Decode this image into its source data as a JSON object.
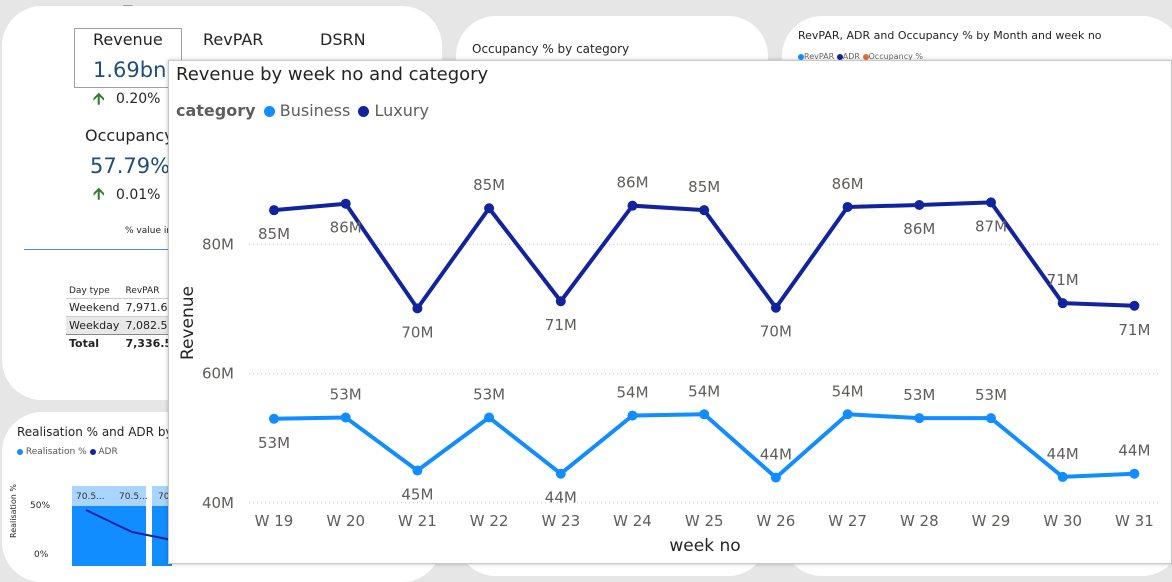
{
  "toolbar": {
    "filter_icon": "filter-icon",
    "more_icon": "more-options-icon"
  },
  "kpi_card": {
    "tabs": [
      "Revenue",
      "RevPAR",
      "DSRN"
    ],
    "revenue_value": "1.69bn",
    "revenue_change": "0.20%",
    "occupancy_label": "Occupancy",
    "occupancy_value": "57.79%",
    "occupancy_change": "0.01%",
    "note": "% value in"
  },
  "day_table": {
    "headers": [
      "Day type",
      "RevPAR"
    ],
    "rows": [
      [
        "Weekend",
        "7,971.6"
      ],
      [
        "Weekday",
        "7,082.5"
      ]
    ],
    "total": [
      "Total",
      "7,336.5"
    ]
  },
  "occupancy_card": {
    "title": "Occupancy % by category"
  },
  "monthly_card": {
    "title": "RevPAR, ADR and Occupancy % by Month and week no",
    "legend": [
      "RevPAR",
      "ADR",
      "Occupancy %"
    ]
  },
  "realisation_card": {
    "title": "Realisation % and ADR by B",
    "legend": [
      "Realisation %",
      "ADR"
    ],
    "ylabel": "Realisation %",
    "ticks": [
      "50%",
      "0%"
    ],
    "bar_labels": [
      "70.5...",
      "70.5...",
      "70"
    ]
  },
  "colors": {
    "business": "#118dff",
    "luxury": "#12239e",
    "accent": "#1f4e79"
  },
  "chart_data": {
    "type": "line",
    "title": "Revenue by week no and category",
    "legend_title": "category",
    "xlabel": "week no",
    "ylabel": "Revenue",
    "categories": [
      "W 19",
      "W 20",
      "W 21",
      "W 22",
      "W 23",
      "W 24",
      "W 25",
      "W 26",
      "W 27",
      "W 28",
      "W 29",
      "W 30",
      "W 31"
    ],
    "yticks": [
      "80M",
      "60M",
      "40M"
    ],
    "ylim": [
      39.5,
      95.7
    ],
    "grid": true,
    "legend_position": "top-left",
    "series": [
      {
        "name": "Business",
        "values": [
          53.0,
          53.2,
          45.0,
          53.2,
          44.5,
          53.5,
          53.7,
          43.9,
          53.7,
          53.1,
          53.1,
          44.0,
          44.5
        ],
        "labels": [
          "53M",
          "53M",
          "45M",
          "53M",
          "44M",
          "54M",
          "54M",
          "44M",
          "54M",
          "53M",
          "53M",
          "44M",
          "44M"
        ]
      },
      {
        "name": "Luxury",
        "values": [
          85.3,
          86.3,
          70.1,
          85.6,
          71.2,
          86.0,
          85.3,
          70.2,
          85.8,
          86.1,
          86.5,
          70.9,
          70.5
        ],
        "labels": [
          "85M",
          "86M",
          "70M",
          "85M",
          "71M",
          "86M",
          "85M",
          "70M",
          "86M",
          "86M",
          "87M",
          "71M",
          "71M"
        ]
      }
    ]
  }
}
